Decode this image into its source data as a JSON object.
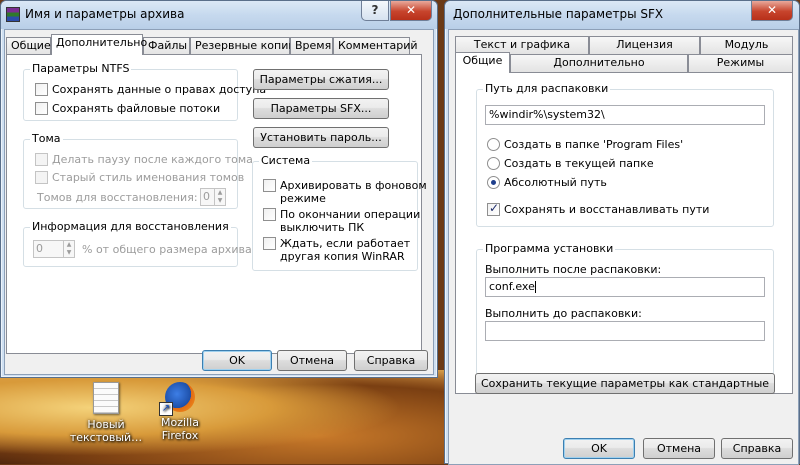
{
  "desktop": {
    "icons": [
      {
        "label_line1": "Новый",
        "label_line2": "текстовый…",
        "icon": "text-document-icon"
      },
      {
        "label_line1": "Mozilla",
        "label_line2": "Firefox",
        "icon": "firefox-icon"
      }
    ]
  },
  "window1": {
    "title": "Имя и параметры архива",
    "help_glyph": "?",
    "close_glyph": "✕",
    "tabs": [
      "Общие",
      "Дополнительно",
      "Файлы",
      "Резервные копии",
      "Время",
      "Комментарий"
    ],
    "active_tab": "Дополнительно",
    "ntfs": {
      "label": "Параметры NTFS",
      "save_security": "Сохранять данные о правах доступа",
      "save_streams": "Сохранять файловые потоки"
    },
    "volumes": {
      "label": "Тома",
      "pause": "Делать паузу после каждого тома",
      "old_naming": "Старый стиль именования томов",
      "recovery_volumes_label": "Томов для восстановления:",
      "recovery_volumes_value": "0"
    },
    "recovery": {
      "label": "Информация для восстановления",
      "value": "0",
      "suffix": "% от общего размера архива"
    },
    "buttons": {
      "compression": "Параметры сжатия...",
      "sfx": "Параметры SFX...",
      "password": "Установить пароль..."
    },
    "system": {
      "label": "Система",
      "background_line1": "Архивировать в фоновом",
      "background_line2": "режиме",
      "shutdown_line1": "По окончании операции",
      "shutdown_line2": "выключить ПК",
      "wait_line1": "Ждать, если работает",
      "wait_line2": "другая копия WinRAR"
    },
    "footer": {
      "ok": "OK",
      "cancel": "Отмена",
      "help": "Справка"
    }
  },
  "window2": {
    "title": "Дополнительные параметры SFX",
    "close_glyph": "✕",
    "tabs_row1": [
      "Текст и графика",
      "Лицензия",
      "Модуль"
    ],
    "tabs_row2": [
      "Общие",
      "Дополнительно",
      "Режимы"
    ],
    "active_tab": "Общие",
    "extract_path": {
      "label": "Путь для распаковки",
      "value": "%windir%\\system32\\",
      "opt_program_files": "Создать в папке 'Program Files'",
      "opt_current": "Создать в текущей папке",
      "opt_absolute": "Абсолютный путь",
      "selected": "Абсолютный путь",
      "keep_paths": "Сохранять и восстанавливать пути",
      "keep_paths_checked": true
    },
    "setup": {
      "label": "Программа установки",
      "run_after_label": "Выполнить после распаковки:",
      "run_after_value": "conf.exe",
      "run_before_label": "Выполнить до распаковки:",
      "run_before_value": ""
    },
    "save_defaults": "Сохранить текущие параметры как стандартные",
    "footer": {
      "ok": "OK",
      "cancel": "Отмена",
      "help": "Справка"
    }
  }
}
